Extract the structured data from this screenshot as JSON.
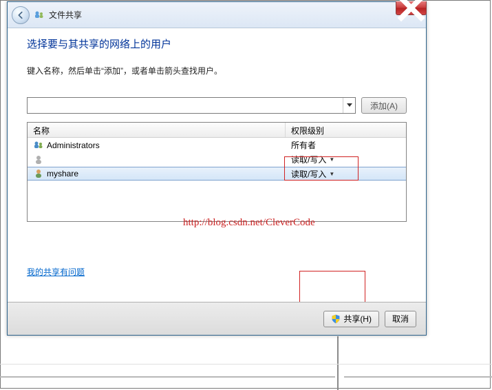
{
  "header": {
    "title": "文件共享"
  },
  "main": {
    "heading": "选择要与其共享的网络上的用户",
    "subtext": "键入名称，然后单击“添加”，或者单击箭头查找用户。",
    "add_button": "添加(A)",
    "columns": {
      "name": "名称",
      "perm": "权限级别"
    },
    "rows": [
      {
        "name": "Administrators",
        "perm": "所有者",
        "dropdown": false,
        "selected": false
      },
      {
        "name": "",
        "perm": "读取/写入",
        "dropdown": true,
        "selected": false
      },
      {
        "name": "myshare",
        "perm": "读取/写入",
        "dropdown": true,
        "selected": true
      }
    ],
    "help_link": "我的共享有问题"
  },
  "footer": {
    "share": "共享(H)",
    "cancel": "取消"
  },
  "watermark": "http://blog.csdn.net/CleverCode"
}
